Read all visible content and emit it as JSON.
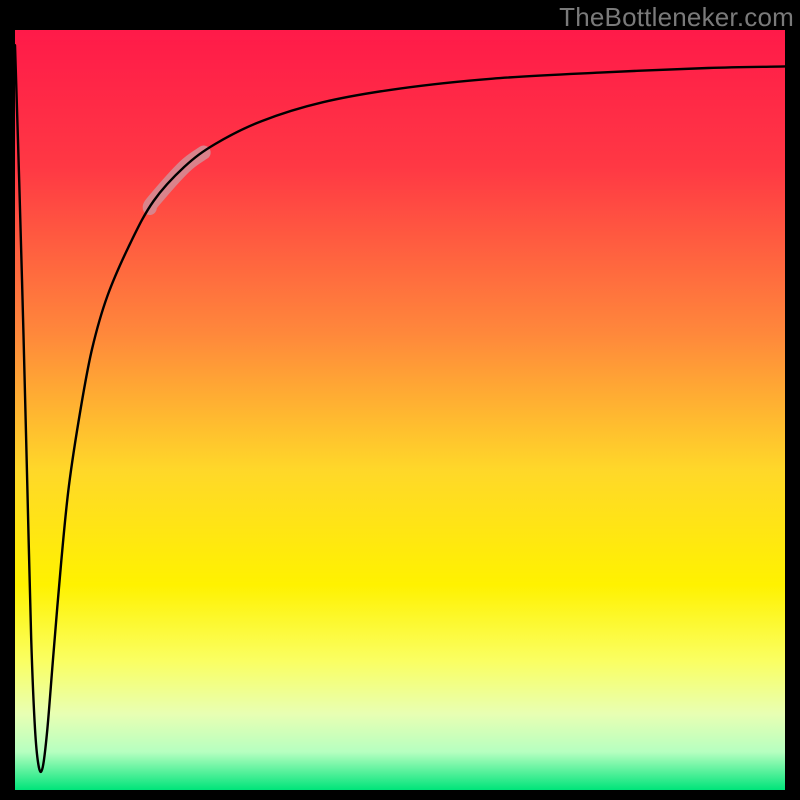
{
  "watermark": "TheBottleneker.com",
  "chart_data": {
    "type": "line",
    "title": "",
    "xlabel": "",
    "ylabel": "",
    "xlim": [
      0,
      100
    ],
    "ylim": [
      0,
      100
    ],
    "grid": false,
    "legend": false,
    "background_gradient": [
      {
        "stop": 0.0,
        "color": "#ff1a49"
      },
      {
        "stop": 0.18,
        "color": "#ff3844"
      },
      {
        "stop": 0.4,
        "color": "#ff883b"
      },
      {
        "stop": 0.58,
        "color": "#ffd829"
      },
      {
        "stop": 0.73,
        "color": "#fff200"
      },
      {
        "stop": 0.83,
        "color": "#faff62"
      },
      {
        "stop": 0.9,
        "color": "#e8ffb3"
      },
      {
        "stop": 0.95,
        "color": "#b6ffc0"
      },
      {
        "stop": 1.0,
        "color": "#00e47a"
      }
    ],
    "series": [
      {
        "name": "curve",
        "color": "#000000",
        "width": 2.4,
        "data": [
          {
            "x": 0.0,
            "y": 98.0
          },
          {
            "x": 0.55,
            "y": 80.0
          },
          {
            "x": 1.1,
            "y": 60.0
          },
          {
            "x": 1.6,
            "y": 40.0
          },
          {
            "x": 2.1,
            "y": 20.0
          },
          {
            "x": 2.6,
            "y": 8.0
          },
          {
            "x": 3.1,
            "y": 3.0
          },
          {
            "x": 3.6,
            "y": 3.0
          },
          {
            "x": 4.2,
            "y": 8.0
          },
          {
            "x": 5.0,
            "y": 18.0
          },
          {
            "x": 6.0,
            "y": 30.0
          },
          {
            "x": 7.0,
            "y": 40.0
          },
          {
            "x": 8.5,
            "y": 50.0
          },
          {
            "x": 10.0,
            "y": 58.0
          },
          {
            "x": 12.0,
            "y": 65.0
          },
          {
            "x": 15.0,
            "y": 72.0
          },
          {
            "x": 18.0,
            "y": 77.5
          },
          {
            "x": 22.0,
            "y": 82.0
          },
          {
            "x": 26.0,
            "y": 85.0
          },
          {
            "x": 32.0,
            "y": 88.0
          },
          {
            "x": 40.0,
            "y": 90.5
          },
          {
            "x": 50.0,
            "y": 92.3
          },
          {
            "x": 62.0,
            "y": 93.6
          },
          {
            "x": 76.0,
            "y": 94.4
          },
          {
            "x": 90.0,
            "y": 95.0
          },
          {
            "x": 100.0,
            "y": 95.2
          }
        ]
      }
    ],
    "highlight": {
      "description": "thick faded pink segment on ascending limb",
      "color": "#d58b93",
      "opacity": 0.9,
      "width": 14,
      "x_range": [
        17.5,
        24.5
      ]
    }
  }
}
